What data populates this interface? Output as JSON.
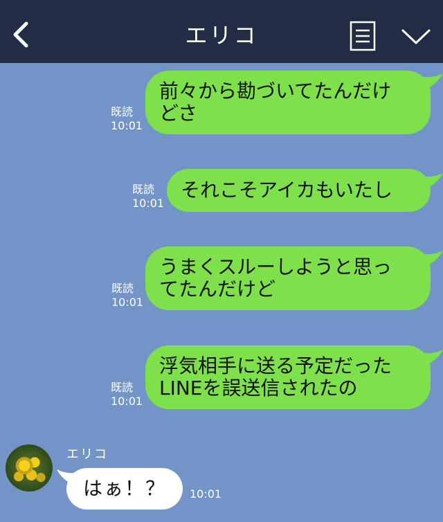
{
  "header": {
    "title": "エリコ",
    "back_icon": "chevron-left-icon",
    "memo_icon": "memo-list-icon",
    "menu_icon": "chevron-down-icon"
  },
  "messages": [
    {
      "read": "既読",
      "time": "10:01",
      "lines": [
        "前々から勘づいてたんだけ",
        "どさ"
      ]
    },
    {
      "read": "既読",
      "time": "10:01",
      "lines": [
        "それこそアイカもいたし"
      ]
    },
    {
      "read": "既読",
      "time": "10:01",
      "lines": [
        "うまくスルーしようと思っ",
        "てたんだけど"
      ]
    },
    {
      "read": "既読",
      "time": "10:01",
      "lines": [
        "浮気相手に送る予定だった",
        "LINEを誤送信されたの"
      ]
    }
  ],
  "incoming": {
    "sender": "エリコ",
    "text": "はぁ！？",
    "time": "10:01",
    "avatar_icon": "mimosa-flower-avatar"
  },
  "colors": {
    "header_bg": "#222d45",
    "chat_bg": "#7394c6",
    "my_bubble": "#7ee04a",
    "their_bubble": "#ffffff"
  }
}
